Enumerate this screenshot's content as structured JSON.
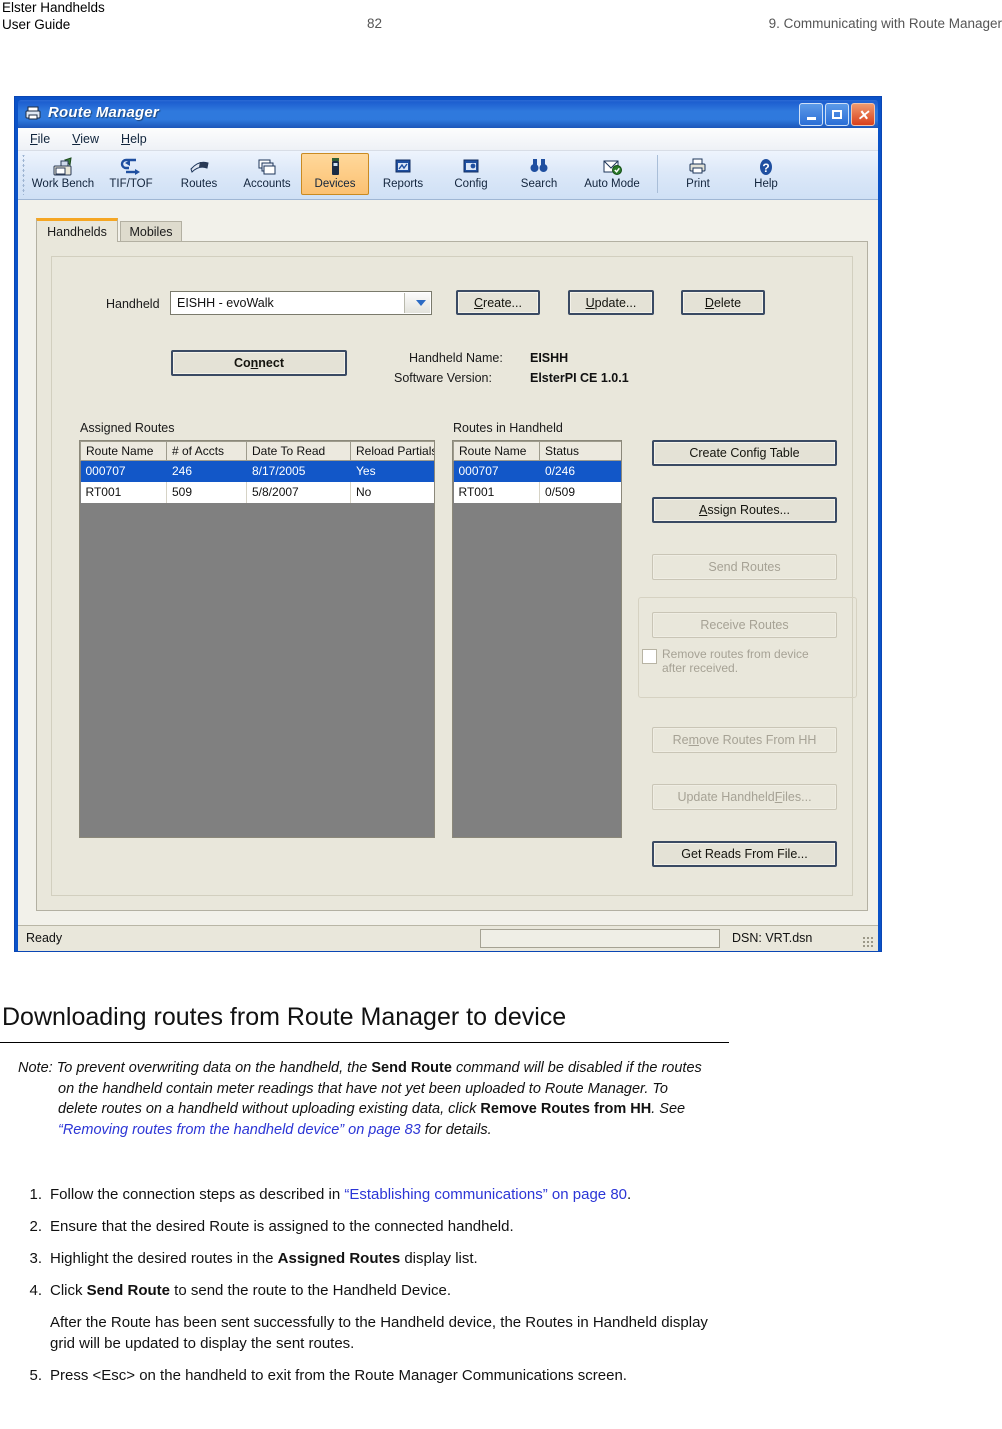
{
  "page_header": {
    "line1": "Elster Handhelds",
    "line2": "User Guide",
    "page_number": "82",
    "chapter": "9. Communicating with Route Manager"
  },
  "app": {
    "title": "Route Manager",
    "title_icon": "printer-icon",
    "window_controls": {
      "minimize": "minimize-icon",
      "maximize": "maximize-icon",
      "close": "close-icon"
    },
    "menu": [
      {
        "label": "File",
        "accel": "F"
      },
      {
        "label": "View",
        "accel": "V"
      },
      {
        "label": "Help",
        "accel": "H"
      }
    ],
    "toolbar": [
      {
        "label": "Work Bench",
        "icon": "workbench-icon",
        "selected": false
      },
      {
        "label": "TIF/TOF",
        "icon": "transfer-icon",
        "selected": false
      },
      {
        "label": "Routes",
        "icon": "routes-icon",
        "selected": false
      },
      {
        "label": "Accounts",
        "icon": "accounts-icon",
        "selected": false
      },
      {
        "label": "Devices",
        "icon": "device-icon",
        "selected": true
      },
      {
        "label": "Reports",
        "icon": "reports-icon",
        "selected": false
      },
      {
        "label": "Config",
        "icon": "config-icon",
        "selected": false
      },
      {
        "label": "Search",
        "icon": "binoculars-icon",
        "selected": false
      },
      {
        "label": "Auto Mode",
        "icon": "automode-icon",
        "selected": false
      },
      {
        "label": "Print",
        "icon": "printer-icon",
        "selected": false
      },
      {
        "label": "Help",
        "icon": "help-icon",
        "selected": false
      }
    ],
    "tabs": [
      {
        "label": "Handhelds",
        "active": true
      },
      {
        "label": "Mobiles",
        "active": false
      }
    ],
    "form": {
      "handheld_label": "Handheld",
      "handheld_value": "EISHH - evoWalk",
      "create_label": "Create...",
      "update_label": "Update...",
      "delete_label": "Delete",
      "connect_label": "Connect",
      "handheld_name_label": "Handheld Name:",
      "handheld_name_value": "EISHH",
      "software_version_label": "Software Version:",
      "software_version_value": "ElsterPI CE 1.0.1"
    },
    "assigned_routes": {
      "title": "Assigned Routes",
      "columns": [
        "Route Name",
        "# of Accts",
        "Date To Read",
        "Reload Partials"
      ],
      "rows": [
        {
          "cells": [
            "000707",
            "246",
            "8/17/2005",
            "Yes"
          ],
          "selected": true
        },
        {
          "cells": [
            "RT001",
            "509",
            "5/8/2007",
            "No"
          ],
          "selected": false
        }
      ]
    },
    "routes_in_handheld": {
      "title": "Routes in Handheld",
      "columns": [
        "Route Name",
        "Status"
      ],
      "rows": [
        {
          "cells": [
            "000707",
            "0/246"
          ],
          "selected": true
        },
        {
          "cells": [
            "RT001",
            "0/509"
          ],
          "selected": false
        }
      ]
    },
    "actions": {
      "create_config_table": "Create Config Table",
      "assign_routes": "Assign Routes...",
      "send_routes": "Send Routes",
      "receive_routes": "Receive Routes",
      "remove_after_received": "Remove routes from device after received.",
      "remove_routes_from_hh": "Remove Routes From HH",
      "update_handheld_files": "Update Handheld Files...",
      "get_reads_from_file": "Get Reads From File..."
    },
    "status_bar": {
      "status": "Ready",
      "progress_value": "",
      "dsn": "DSN: VRT.dsn"
    }
  },
  "document": {
    "heading": "Downloading routes from Route Manager to device",
    "note": {
      "prefix": "Note:",
      "part1": " To prevent overwriting data on the handheld, the ",
      "bold1": "Send Route",
      "part2": " command will be disabled if the routes on the handheld contain meter readings that have not yet been uploaded to Route Manager. To delete routes on a handheld without uploading existing data, click ",
      "bold2": "Remove Routes from HH",
      "part3": ". See ",
      "link": "“Removing routes from the handheld device” on page 83",
      "part4": " for details."
    },
    "steps": [
      {
        "num": "1.",
        "part1": "Follow the connection steps as described in ",
        "link": "“Establishing communications” on page 80",
        "part2": "."
      },
      {
        "num": "2.",
        "part1": "Ensure that the desired Route is assigned to the connected handheld.",
        "link": "",
        "part2": ""
      },
      {
        "num": "3.",
        "part1": "Highlight the desired routes in the ",
        "bold": "Assigned Routes",
        "part2": " display list."
      },
      {
        "num": "4.",
        "part1": "Click ",
        "bold": "Send Route",
        "part2": " to send the route to the Handheld Device."
      }
    ],
    "step4_followup": "After the Route has been sent successfully to the Handheld device, the Routes in Handheld display grid will be updated to display the sent routes.",
    "step5": {
      "num": "5.",
      "text": "Press <Esc> on the handheld to exit from the Route Manager Communications screen."
    }
  }
}
